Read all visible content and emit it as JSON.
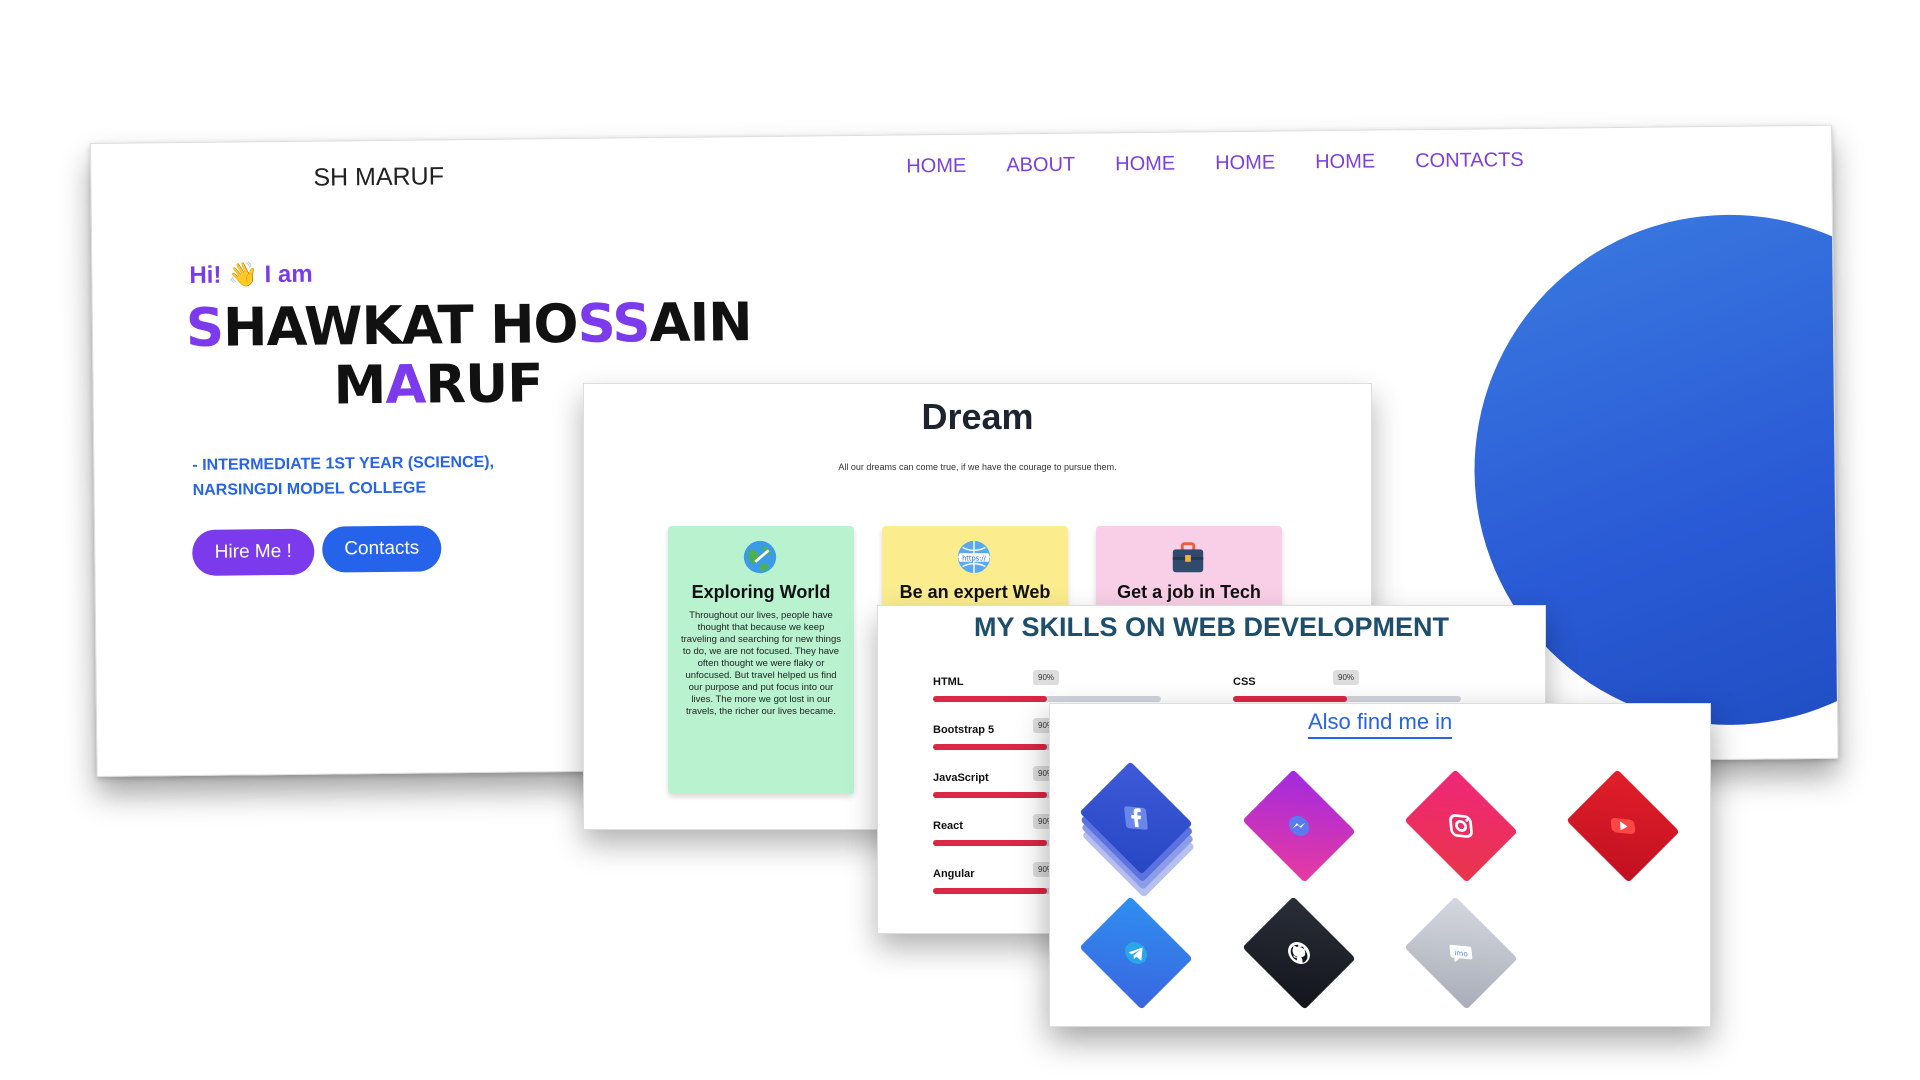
{
  "hero": {
    "brand": "SH MARUF",
    "nav": [
      "HOME",
      "ABOUT",
      "HOME",
      "HOME",
      "HOME",
      "CONTACTS"
    ],
    "greeting": "Hi! 👋 I am",
    "name_line1_first": "S",
    "name_line1_mid1": "HAWKAT HO",
    "name_line1_acc": "SS",
    "name_line1_end": "AIN",
    "name_line2_start": "M",
    "name_line2_acc": "A",
    "name_line2_end": "RUF",
    "education_line1": "- INTERMEDIATE 1ST YEAR (SCIENCE),",
    "education_line2": "NARSINGDI MODEL COLLEGE",
    "hire_button": "Hire Me !",
    "contacts_button": "Contacts",
    "colors": {
      "accent": "#7c3aed",
      "blue": "#2563eb"
    }
  },
  "dream": {
    "title": "Dream",
    "subtitle": "All our dreams can come true, if we have the courage to pursue them.",
    "cards": [
      {
        "title": "Exploring World",
        "icon": "globe-icon",
        "text": "Throughout our lives, people have thought that because we keep traveling and searching for new things to do, we are not focused. They have often thought we were flaky or unfocused. But travel helped us find our purpose and put focus into our lives. The more we got lost in our travels, the richer our lives became."
      },
      {
        "title": "Be an expert Web",
        "icon": "web-globe-icon",
        "text": ""
      },
      {
        "title": "Get a job in Tech",
        "icon": "briefcase-icon",
        "text": ""
      }
    ]
  },
  "skills": {
    "title": "MY SKILLS ON WEB DEVELOPMENT",
    "items": [
      {
        "name": "HTML",
        "pct_label": "90%",
        "value": 0.5
      },
      {
        "name": "CSS",
        "pct_label": "90%",
        "value": 0.5
      },
      {
        "name": "Bootstrap 5",
        "pct_label": "90%",
        "value": 0.5
      },
      {
        "name": "JavaScript",
        "pct_label": "90%",
        "value": 0.5
      },
      {
        "name": "React",
        "pct_label": "90%",
        "value": 0.5
      },
      {
        "name": "Angular",
        "pct_label": "90%",
        "value": 0.5
      }
    ]
  },
  "social": {
    "title": "Also find me in",
    "icons": [
      "facebook-icon",
      "messenger-icon",
      "instagram-icon",
      "youtube-icon",
      "telegram-icon",
      "github-icon",
      "imo-icon"
    ]
  }
}
